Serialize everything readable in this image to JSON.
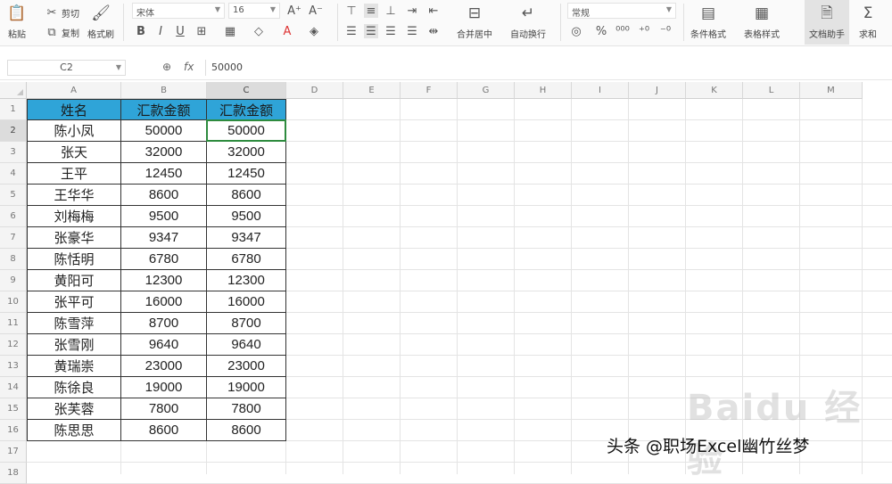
{
  "ribbon": {
    "paste": "粘贴",
    "cut": "剪切",
    "copy": "复制",
    "format_painter": "格式刷",
    "font_name": "宋体",
    "font_size": "16",
    "merge_center": "合并居中",
    "wrap_text": "自动换行",
    "number_format": "常规",
    "conditional_format": "条件格式",
    "table_style": "表格样式",
    "doc_assistant": "文档助手",
    "sum": "求和"
  },
  "formula_bar": {
    "cell_ref": "C2",
    "fx_label": "fx",
    "content": "50000"
  },
  "columns": [
    "A",
    "B",
    "C",
    "D",
    "E",
    "F",
    "G",
    "H",
    "I",
    "J",
    "K",
    "L",
    "M"
  ],
  "rows": [
    "1",
    "2",
    "3",
    "4",
    "5",
    "6",
    "7",
    "8",
    "9",
    "10",
    "11",
    "12",
    "13",
    "14",
    "15",
    "16",
    "17",
    "18"
  ],
  "table": {
    "headers": [
      "姓名",
      "汇款金额",
      "汇款金额"
    ],
    "rows": [
      [
        "陈小凤",
        "50000",
        "50000"
      ],
      [
        "张天",
        "32000",
        "32000"
      ],
      [
        "王平",
        "12450",
        "12450"
      ],
      [
        "王华华",
        "8600",
        "8600"
      ],
      [
        "刘梅梅",
        "9500",
        "9500"
      ],
      [
        "张豪华",
        "9347",
        "9347"
      ],
      [
        "陈恬明",
        "6780",
        "6780"
      ],
      [
        "黄阳可",
        "12300",
        "12300"
      ],
      [
        "张平可",
        "16000",
        "16000"
      ],
      [
        "陈雪萍",
        "8700",
        "8700"
      ],
      [
        "张雪刚",
        "9640",
        "9640"
      ],
      [
        "黄瑞崇",
        "23000",
        "23000"
      ],
      [
        "陈徐良",
        "19000",
        "19000"
      ],
      [
        "张芙蓉",
        "7800",
        "7800"
      ],
      [
        "陈思思",
        "8600",
        "8600"
      ]
    ]
  },
  "colors": {
    "header_fill": "#2fa4d8",
    "selection_border": "#2e8b3e"
  },
  "watermark": {
    "baidu": "Baidu 经验",
    "author": "头条 @职场Excel幽竹丝梦"
  }
}
